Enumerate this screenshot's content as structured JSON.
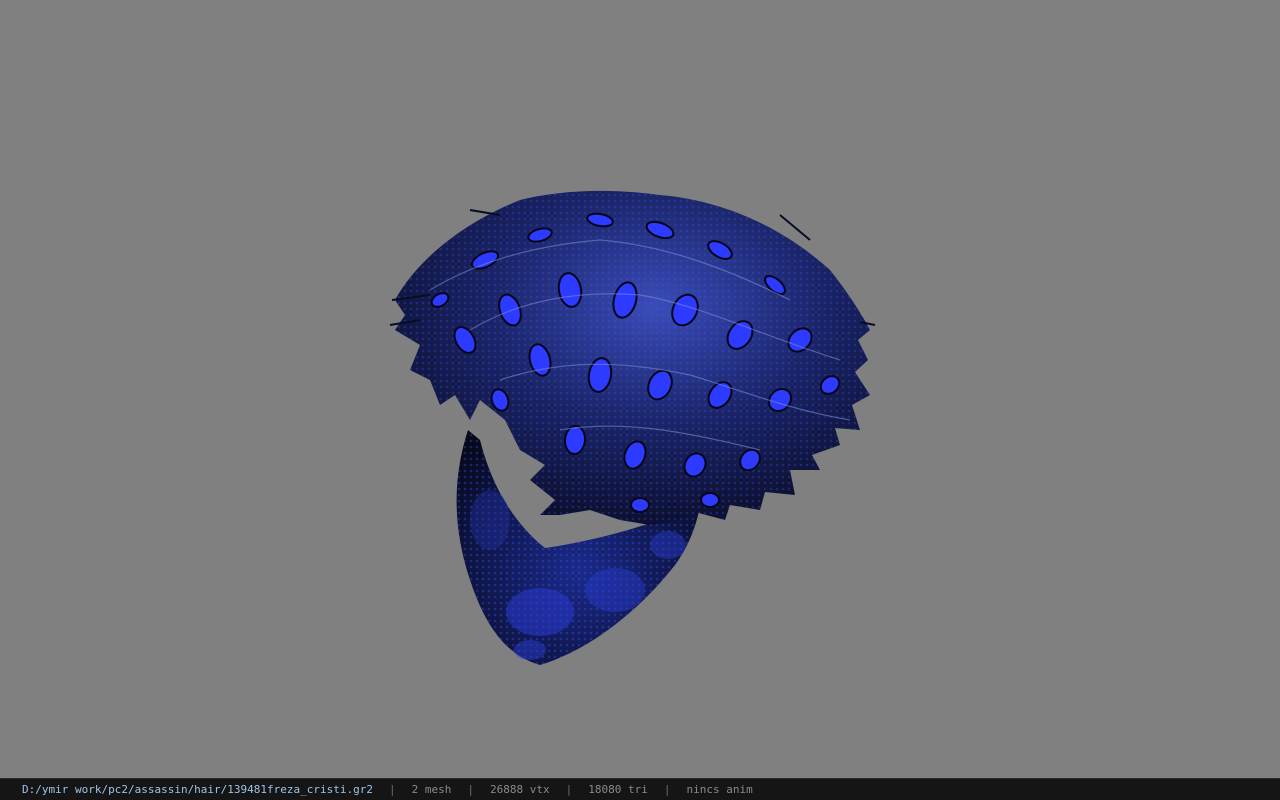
{
  "viewer": {
    "background_color": "#808080",
    "model_colors": {
      "hair_dark": "#0d0f2e",
      "hair_mid": "#1c2d7a",
      "hair_glow": "#2c3bff",
      "hair_highlight": "#7f8fd6"
    }
  },
  "status_bar": {
    "file_path": "D:/ymir work/pc2/assassin/hair/139481freza_cristi.gr2",
    "separator": "|",
    "mesh_count": "2 mesh",
    "vertex_count": "26888 vtx",
    "triangle_count": "18080 tri",
    "anim_status": "nincs anim"
  }
}
